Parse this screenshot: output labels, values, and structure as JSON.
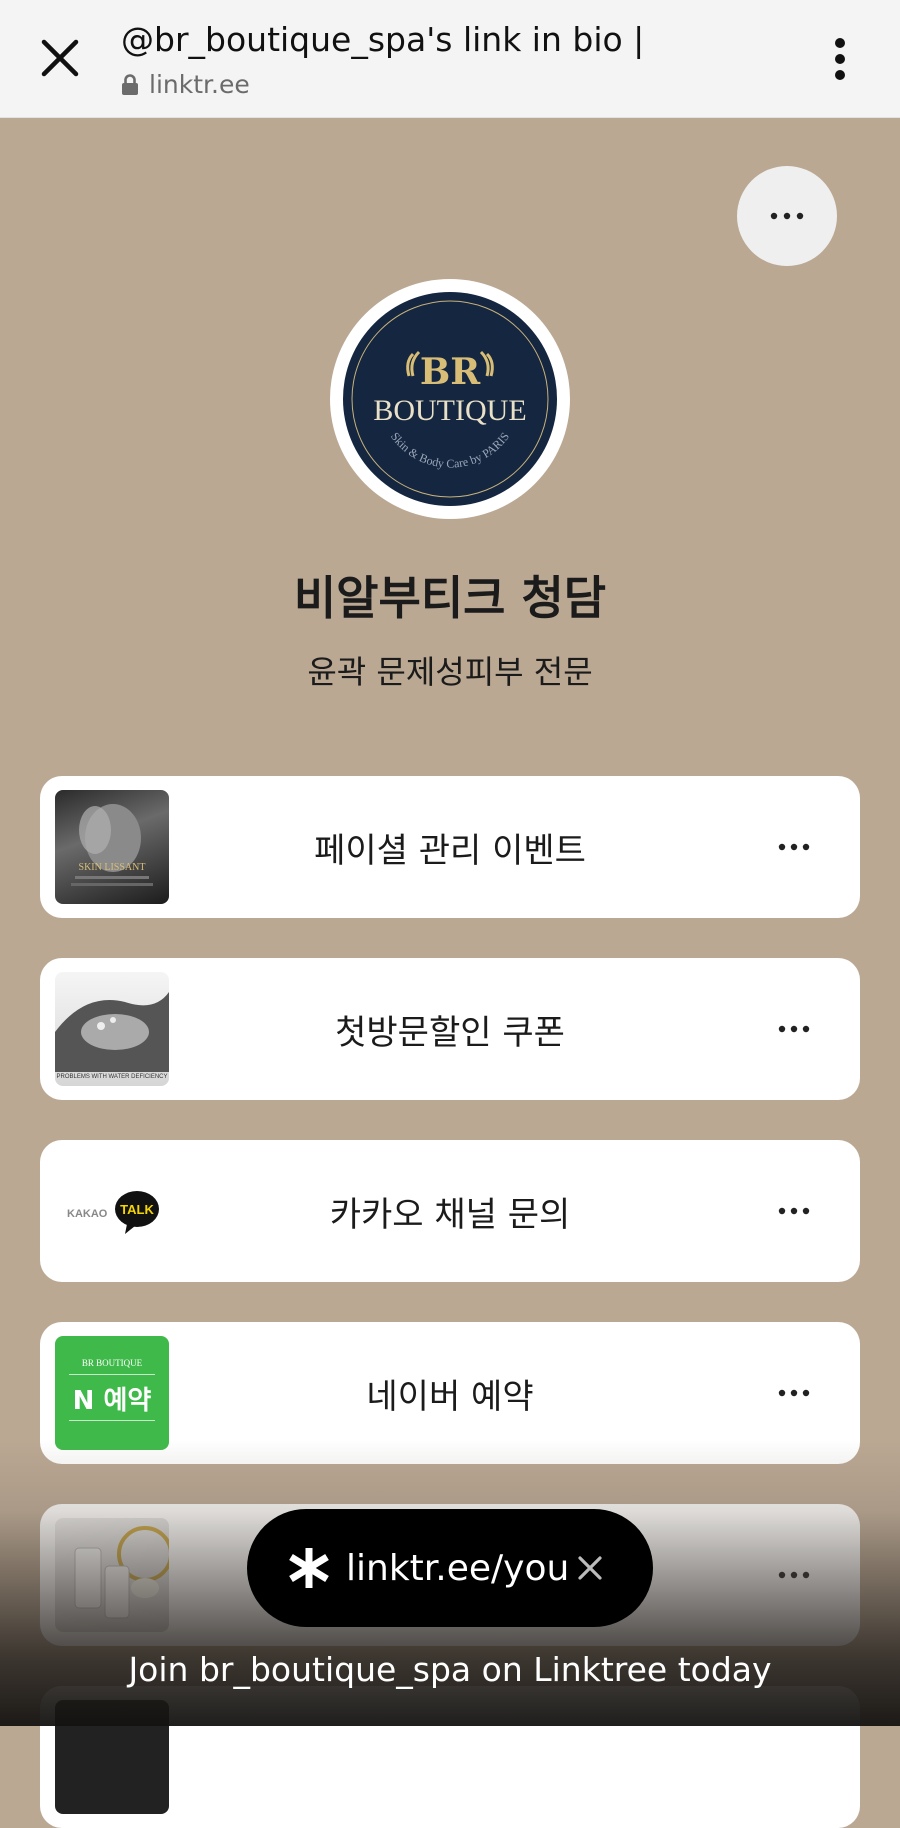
{
  "browser": {
    "title": "@br_boutique_spa's link in bio |",
    "url": "linktr.ee"
  },
  "profile": {
    "avatar_logo_text": "BR",
    "avatar_brand": "BOUTIQUE",
    "avatar_tagline": "Skin & Body Care by PARIS",
    "name": "비알부티크 청담",
    "bio": "윤곽 문제성피부 전문"
  },
  "links": [
    {
      "label": "페이셜 관리 이벤트",
      "thumb_text": "SKIN LISSANT"
    },
    {
      "label": "첫방문할인 쿠폰",
      "thumb_text": "PROBLEMS WITH WATER DEFICIENCY"
    },
    {
      "label": "카카오 채널 문의",
      "thumb_text": "KAKAO",
      "thumb_badge": "TALK"
    },
    {
      "label": "네이버 예약",
      "thumb_text": "BR BOUTIQUE",
      "thumb_badge": "N 예약"
    },
    {
      "label": ""
    }
  ],
  "promo": {
    "pill_text": "linktr.ee/you",
    "join_text": "Join br_boutique_spa on Linktree today"
  },
  "colors": {
    "page_bg": "#bba893",
    "avatar_navy": "#142640",
    "gold": "#d8bd77",
    "naver_green": "#3fba4a"
  }
}
